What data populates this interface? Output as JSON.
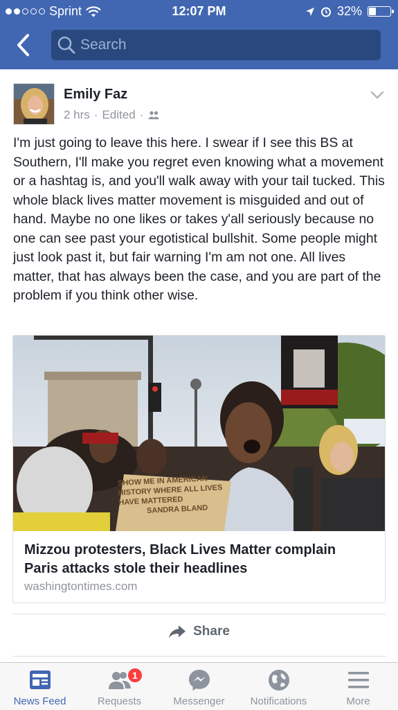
{
  "status_bar": {
    "carrier": "Sprint",
    "time": "12:07 PM",
    "battery": "32%",
    "battery_level": 0.32,
    "signal_bars_filled": 2,
    "icons": [
      "signal-dots-icon",
      "wifi-icon",
      "location-arrow-icon",
      "alarm-icon",
      "battery-icon"
    ]
  },
  "nav": {
    "back_icon": "chevron-left-icon",
    "search_placeholder": "Search"
  },
  "post": {
    "author": "Emily Faz",
    "time": "2 hrs",
    "edited": "Edited",
    "separator": "·",
    "audience_icon": "friends-icon",
    "text": "I'm just going to leave this here. I swear if I see this BS at Southern, I'll make you regret even knowing what a movement or a hashtag is, and you'll walk away with your tail tucked. This whole black lives matter movement is misguided and out of hand. Maybe no one likes or takes y'all seriously because no one can see past your egotistical bullshit. Some people might just look past it, but fair warning I'm am not one. All lives matter, that has always been the case, and you are part of the problem if you think other wise.",
    "link": {
      "title": "Mizzou protesters, Black Lives Matter complain Paris attacks stole their headlines",
      "domain": "washingtontimes.com",
      "photo_sign_text": "SHOW ME IN AMERICAN HISTORY WHERE ALL LIVES HAVE MATTERED",
      "photo_sign_lines": [
        "SHOW ME IN AMERICAN",
        "HISTORY WHERE ALL LIVES",
        "HAVE MATTERED"
      ],
      "photo_sign_name": "SANDRA BLAND"
    },
    "share_label": "Share"
  },
  "tabbar": {
    "tabs": [
      {
        "label": "News Feed",
        "icon": "news-feed-icon",
        "active": true
      },
      {
        "label": "Requests",
        "icon": "friend-requests-icon",
        "badge": "1"
      },
      {
        "label": "Messenger",
        "icon": "messenger-icon"
      },
      {
        "label": "Notifications",
        "icon": "globe-icon"
      },
      {
        "label": "More",
        "icon": "hamburger-menu-icon"
      }
    ]
  },
  "colors": {
    "facebook_blue": "#4267b2",
    "search_field": "#29487d",
    "badge_red": "#fa3e3e",
    "secondary_text": "#90949c"
  }
}
